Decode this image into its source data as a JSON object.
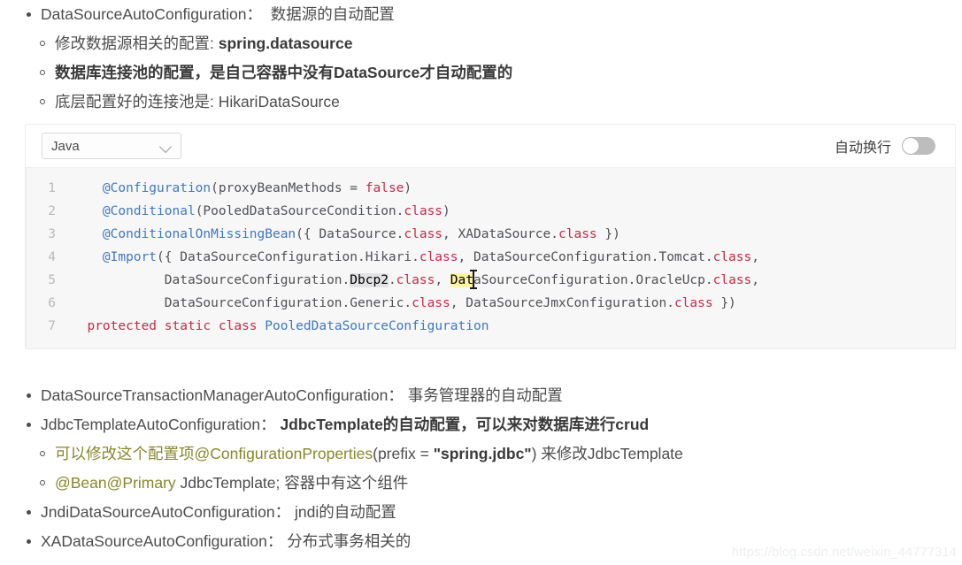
{
  "top_list": {
    "item": {
      "title": "DataSourceAutoConfiguration：",
      "desc": "数据源的自动配置"
    },
    "sub_items": [
      {
        "prefix": "修改数据源相关的配置: ",
        "strong": "spring.datasource",
        "suffix": "",
        "bold_all": false
      },
      {
        "prefix": "",
        "strong": "数据库连接池的配置，是自己容器中没有DataSource才自动配置的",
        "suffix": "",
        "bold_all": true
      },
      {
        "prefix": "底层配置好的连接池是: HikariDataSource",
        "strong": "",
        "suffix": "",
        "bold_all": false
      }
    ]
  },
  "code_block": {
    "language_label": "Java",
    "language_options": [
      "Java"
    ],
    "wrap_label": "自动换行",
    "wrap_enabled": false,
    "line_numbers": [
      "1",
      "2",
      "3",
      "4",
      "5",
      "6",
      "7"
    ],
    "lines": [
      {
        "n": "1",
        "segments": [
          {
            "t": "    ",
            "c": "ctext"
          },
          {
            "t": "@Configuration",
            "c": "ann"
          },
          {
            "t": "(proxyBeanMethods = ",
            "c": "ctext"
          },
          {
            "t": "false",
            "c": "lit"
          },
          {
            "t": ")",
            "c": "ctext"
          }
        ]
      },
      {
        "n": "2",
        "segments": [
          {
            "t": "    ",
            "c": "ctext"
          },
          {
            "t": "@Conditional",
            "c": "ann"
          },
          {
            "t": "(PooledDataSourceCondition.",
            "c": "ctext"
          },
          {
            "t": "class",
            "c": "kw"
          },
          {
            "t": ")",
            "c": "ctext"
          }
        ]
      },
      {
        "n": "3",
        "segments": [
          {
            "t": "    ",
            "c": "ctext"
          },
          {
            "t": "@ConditionalOnMissingBean",
            "c": "ann"
          },
          {
            "t": "({ DataSource.",
            "c": "ctext"
          },
          {
            "t": "class",
            "c": "kw"
          },
          {
            "t": ", XADataSource.",
            "c": "ctext"
          },
          {
            "t": "class",
            "c": "kw"
          },
          {
            "t": " })",
            "c": "ctext"
          }
        ]
      },
      {
        "n": "4",
        "segments": [
          {
            "t": "    ",
            "c": "ctext"
          },
          {
            "t": "@Import",
            "c": "ann"
          },
          {
            "t": "({ DataSourceConfiguration.Hikari.",
            "c": "ctext"
          },
          {
            "t": "class",
            "c": "kw"
          },
          {
            "t": ", DataSourceConfiguration.Tomcat.",
            "c": "ctext"
          },
          {
            "t": "class",
            "c": "kw"
          },
          {
            "t": ",",
            "c": "ctext"
          }
        ]
      },
      {
        "n": "5",
        "segments": [
          {
            "t": "            DataSourceConfiguration.",
            "c": "ctext"
          },
          {
            "t": "Dbcp2",
            "c": "sel-gray"
          },
          {
            "t": ".",
            "c": "ctext"
          },
          {
            "t": "class",
            "c": "kw"
          },
          {
            "t": ", ",
            "c": "ctext"
          },
          {
            "t": "Dat",
            "c": "hl-yellow"
          },
          {
            "t": "aSourceConfiguration.OracleUcp.",
            "c": "ctext"
          },
          {
            "t": "class",
            "c": "kw"
          },
          {
            "t": ",",
            "c": "ctext"
          }
        ]
      },
      {
        "n": "6",
        "segments": [
          {
            "t": "            DataSourceConfiguration.Generic.",
            "c": "ctext"
          },
          {
            "t": "class",
            "c": "kw"
          },
          {
            "t": ", DataSourceJmxConfiguration.",
            "c": "ctext"
          },
          {
            "t": "class",
            "c": "kw"
          },
          {
            "t": " })",
            "c": "ctext"
          }
        ]
      },
      {
        "n": "7",
        "segments": [
          {
            "t": "  ",
            "c": "ctext"
          },
          {
            "t": "protected static class ",
            "c": "kw"
          },
          {
            "t": "PooledDataSourceConfiguration",
            "c": "typ"
          }
        ]
      }
    ]
  },
  "bottom_list": [
    {
      "type": "l1",
      "parts": [
        {
          "t": "DataSourceTransactionManagerAutoConfiguration：  事务管理器的自动配置",
          "c": "plain"
        }
      ]
    },
    {
      "type": "l1",
      "parts": [
        {
          "t": "JdbcTemplateAutoConfiguration：  ",
          "c": "plain"
        },
        {
          "t": "JdbcTemplate的自动配置，可以来对数据库进行crud",
          "c": "bold"
        }
      ]
    },
    {
      "type": "l2",
      "parts": [
        {
          "t": "可以修改这个配置项@ConfigurationProperties",
          "c": "olive"
        },
        {
          "t": "(prefix = ",
          "c": "plain"
        },
        {
          "t": "\"spring.jdbc\"",
          "c": "bold"
        },
        {
          "t": ") 来修改JdbcTemplate",
          "c": "plain"
        }
      ]
    },
    {
      "type": "l2",
      "parts": [
        {
          "t": "@Bean@Primary",
          "c": "olive"
        },
        {
          "t": "   JdbcTemplate; 容器中有这个组件",
          "c": "plain"
        }
      ]
    },
    {
      "type": "l1",
      "parts": [
        {
          "t": "JndiDataSourceAutoConfiguration：  jndi的自动配置",
          "c": "plain"
        }
      ]
    },
    {
      "type": "l1",
      "parts": [
        {
          "t": "XADataSourceAutoConfiguration：  分布式事务相关的",
          "c": "plain"
        }
      ]
    }
  ],
  "watermark": {
    "text": "https://blog.csdn.net/weixin_44777314"
  },
  "colors": {
    "text": "#4d4d4d",
    "annotation": "#4078c0",
    "keyword": "#c62a47",
    "olive": "#87882c",
    "code_bg": "#f7f7f8",
    "highlight_yellow": "#fdf3a0",
    "selection_gray": "#e3e3e6"
  }
}
